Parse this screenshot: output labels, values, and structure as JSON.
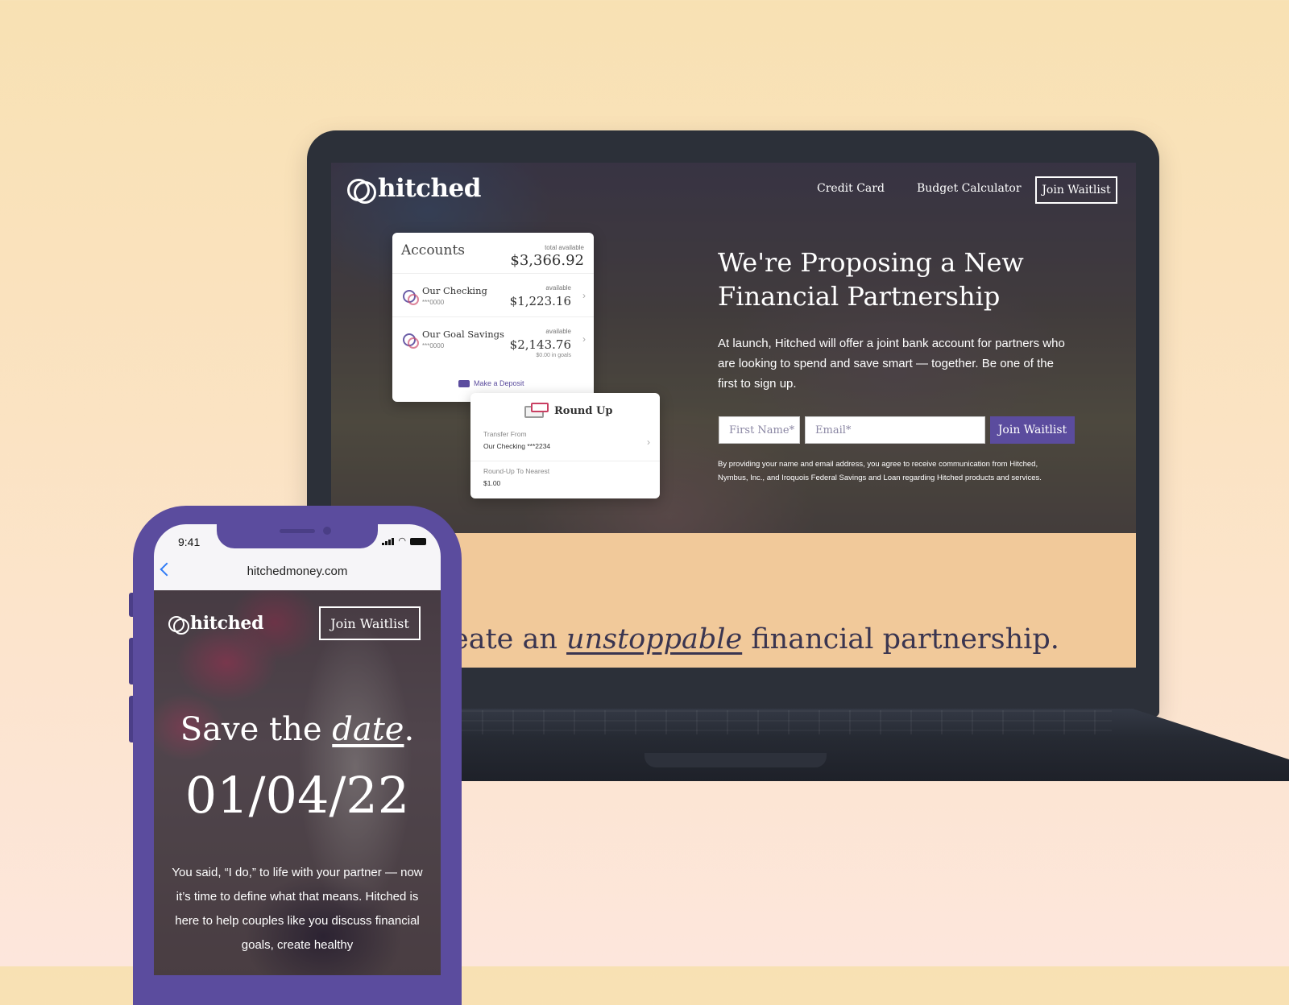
{
  "laptop": {
    "brand": "hitched",
    "nav": {
      "credit_card": "Credit Card",
      "budget_calculator": "Budget Calculator",
      "join_waitlist": "Join Waitlist"
    },
    "hero": {
      "title": "We're Proposing a New Financial Partnership",
      "text": "At launch, Hitched will offer a joint bank account for partners who are looking to spend and save smart — together. Be one of the first to sign up.",
      "first_name_placeholder": "First Name*",
      "email_placeholder": "Email*",
      "submit": "Join Waitlist",
      "disclaimer": "By providing your name and email address, you agree to receive communication from Hitched, Nymbus, Inc., and Iroquois Federal Savings and Loan regarding Hitched products and services."
    },
    "accounts_card": {
      "title": "Accounts",
      "total_label": "total available",
      "total_value": "$3,366.92",
      "accounts": [
        {
          "name": "Our Checking",
          "number": "***0000",
          "available_label": "available",
          "amount": "$1,223.16",
          "goals": ""
        },
        {
          "name": "Our Goal Savings",
          "number": "***0000",
          "available_label": "available",
          "amount": "$2,143.76",
          "goals": "$0.00 in goals"
        }
      ],
      "deposit_label": "Make a Deposit"
    },
    "roundup_card": {
      "title": "Round Up",
      "transfer_label": "Transfer From",
      "transfer_value": "Our Checking ***2234",
      "nearest_label": "Round-Up To Nearest",
      "nearest_value": "$1.00"
    },
    "tagline": {
      "before": "eate an ",
      "emphasis": "unstoppable",
      "after": " financial partnership."
    }
  },
  "phone": {
    "time": "9:41",
    "url": "hitchedmoney.com",
    "brand": "hitched",
    "join_waitlist": "Join Waitlist",
    "save_the": "Save the ",
    "date_word": "date",
    "period": ".",
    "date": "01/04/22",
    "text": "You said, “I do,” to life with your partner — now it’s time to define what that means. Hitched is here to help couples like you discuss financial goals, create healthy"
  },
  "colors": {
    "brand_purple": "#5b4c9e",
    "accent_pink": "#c93f62",
    "ios_blue": "#2f7bf6"
  },
  "icons": [
    "hitched-logo-icon",
    "chevron-right-icon",
    "deposit-icon",
    "round-up-icon",
    "back-arrow-icon",
    "signal-icon",
    "wifi-icon",
    "battery-icon"
  ]
}
